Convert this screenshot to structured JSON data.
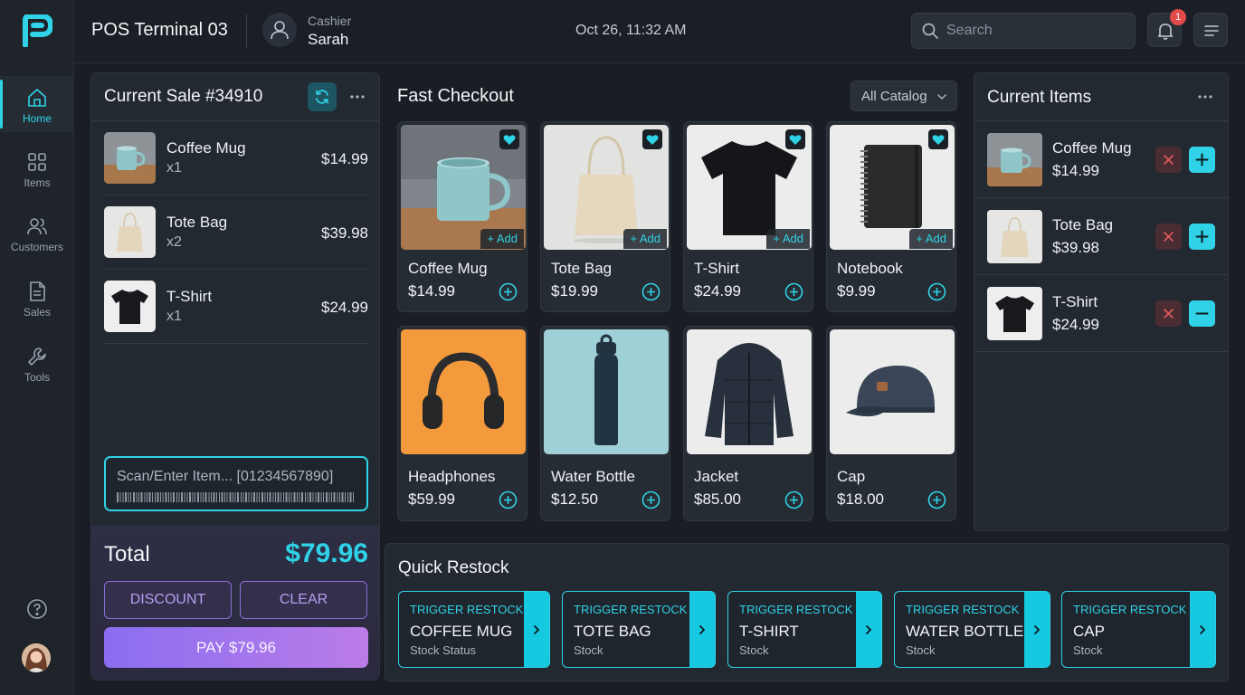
{
  "topbar": {
    "terminal_title": "POS Terminal 03",
    "cashier_role": "Cashier",
    "cashier_name": "Sarah",
    "datetime": "Oct 26, 11:32 AM",
    "search_placeholder": "Search",
    "notification_count": "1"
  },
  "sidebar": {
    "items": [
      {
        "label": "Home",
        "icon": "home-icon",
        "active": true
      },
      {
        "label": "Items",
        "icon": "grid-icon"
      },
      {
        "label": "Customers",
        "icon": "users-icon"
      },
      {
        "label": "Sales",
        "icon": "document-icon"
      },
      {
        "label": "Tools",
        "icon": "wrench-icon"
      }
    ]
  },
  "current_sale": {
    "title": "Current Sale #34910",
    "rows": [
      {
        "name": "Coffee Mug",
        "qty": "x1",
        "price": "$14.99"
      },
      {
        "name": "Tote Bag",
        "qty": "x2",
        "price": "$39.98"
      },
      {
        "name": "T-Shirt",
        "qty": "x1",
        "price": "$24.99"
      }
    ],
    "scan_placeholder": "Scan/Enter Item... [01234567890]",
    "total_label": "Total",
    "total_value": "$79.96",
    "discount_label": "DISCOUNT",
    "clear_label": "CLEAR",
    "pay_label": "PAY $79.96"
  },
  "fast_checkout": {
    "title": "Fast Checkout",
    "catalog_filter": "All Catalog",
    "add_label": "+ Add",
    "products": [
      {
        "name": "Coffee Mug",
        "price": "$14.99",
        "favorite": true
      },
      {
        "name": "Tote Bag",
        "price": "$19.99",
        "favorite": true
      },
      {
        "name": "T-Shirt",
        "price": "$24.99",
        "favorite": true
      },
      {
        "name": "Notebook",
        "price": "$9.99",
        "favorite": true
      },
      {
        "name": "Headphones",
        "price": "$59.99"
      },
      {
        "name": "Water Bottle",
        "price": "$12.50"
      },
      {
        "name": "Jacket",
        "price": "$85.00"
      },
      {
        "name": "Cap",
        "price": "$18.00"
      }
    ]
  },
  "current_items": {
    "title": "Current Items",
    "rows": [
      {
        "name": "Coffee Mug",
        "price": "$14.99",
        "action": "plus"
      },
      {
        "name": "Tote Bag",
        "price": "$39.98",
        "action": "plus"
      },
      {
        "name": "T-Shirt",
        "price": "$24.99",
        "action": "minus"
      }
    ]
  },
  "quick_restock": {
    "title": "Quick Restock",
    "cards": [
      {
        "trigger": "TRIGGER RESTOCK",
        "name": "COFFEE MUG",
        "sub": "Stock Status"
      },
      {
        "trigger": "TRIGGER RESTOCK",
        "name": "TOTE BAG",
        "sub": "Stock"
      },
      {
        "trigger": "TRIGGER RESTOCK",
        "name": "T-SHIRT",
        "sub": "Stock"
      },
      {
        "trigger": "TRIGGER RESTOCK",
        "name": "WATER BOTTLE",
        "sub": "Stock"
      },
      {
        "trigger": "TRIGGER RESTOCK",
        "name": "CAP",
        "sub": "Stock"
      }
    ]
  },
  "colors": {
    "accent": "#2fd2e6",
    "background": "#1a1e24",
    "panel": "#232930",
    "pay_gradient_start": "#8a6ef0",
    "pay_gradient_end": "#bb7ce8"
  }
}
